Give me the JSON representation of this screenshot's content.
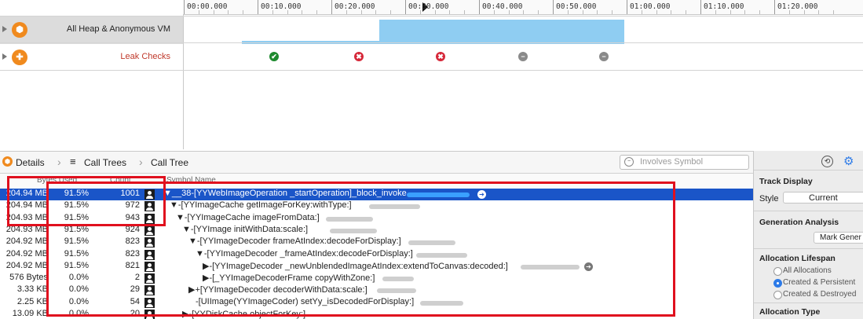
{
  "timeline": {
    "ruler_labels": [
      "00:00.000",
      "00:10.000",
      "00:20.000",
      "00:30.000",
      "00:40.000",
      "00:50.000",
      "01:00.000",
      "01:10.000",
      "01:20.000"
    ],
    "tracks": [
      {
        "label": "All Heap & Anonymous VM",
        "icon": "allocations-icon",
        "label_color": "#222222",
        "selected": true
      },
      {
        "label": "Leak Checks",
        "icon": "leaks-icon",
        "label_color": "#c0392b",
        "selected": false
      }
    ],
    "leak_checks": [
      {
        "status": "ok",
        "color": "#1e8a2e",
        "glyph": "✔"
      },
      {
        "status": "leak",
        "color": "#d62839",
        "glyph": "✖"
      },
      {
        "status": "leak",
        "color": "#d62839",
        "glyph": "✖"
      },
      {
        "status": "none",
        "color": "#8a8a8a",
        "glyph": "−"
      },
      {
        "status": "none",
        "color": "#8a8a8a",
        "glyph": "−"
      }
    ]
  },
  "jumpbar": {
    "details_label": "Details",
    "call_trees_label": "Call Trees",
    "call_tree_label": "Call Tree",
    "search_placeholder": "Involves Symbol"
  },
  "table": {
    "headers": {
      "bytes": "Bytes Used",
      "count": "Count",
      "symbol": "Symbol Name"
    },
    "rows": [
      {
        "bytes": "204.94 MB",
        "pct": "91.5%",
        "count": "1001",
        "symbol": "▼__38-[YYWebImageOperation _startOperation]_block_invoke",
        "selected": true
      },
      {
        "bytes": "204.94 MB",
        "pct": "91.5%",
        "count": "972",
        "symbol": "▼-[YYImageCache getImageForKey:withType:]"
      },
      {
        "bytes": "204.93 MB",
        "pct": "91.5%",
        "count": "943",
        "symbol": "▼-[YYImageCache imageFromData:]"
      },
      {
        "bytes": "204.93 MB",
        "pct": "91.5%",
        "count": "924",
        "symbol": "▼-[YYImage initWithData:scale:]"
      },
      {
        "bytes": "204.92 MB",
        "pct": "91.5%",
        "count": "823",
        "symbol": "▼-[YYImageDecoder frameAtIndex:decodeForDisplay:]"
      },
      {
        "bytes": "204.92 MB",
        "pct": "91.5%",
        "count": "823",
        "symbol": "▼-[YYImageDecoder _frameAtIndex:decodeForDisplay:]"
      },
      {
        "bytes": "204.92 MB",
        "pct": "91.5%",
        "count": "821",
        "symbol": "▶-[YYImageDecoder _newUnblendedImageAtIndex:extendToCanvas:decoded:]"
      },
      {
        "bytes": "576 Bytes",
        "pct": "0.0%",
        "count": "2",
        "symbol": "▶-[_YYImageDecoderFrame copyWithZone:]"
      },
      {
        "bytes": "3.33 KB",
        "pct": "0.0%",
        "count": "29",
        "symbol": "▶+[YYImageDecoder decoderWithData:scale:]"
      },
      {
        "bytes": "2.25 KB",
        "pct": "0.0%",
        "count": "54",
        "symbol": "-[UIImage(YYImageCoder) setYy_isDecodedForDisplay:]"
      },
      {
        "bytes": "13.09 KB",
        "pct": "0.0%",
        "count": "20",
        "symbol": "▶-[YYDiskCache objectForKey:]"
      }
    ]
  },
  "inspector": {
    "track_display": "Track Display",
    "style_label": "Style",
    "style_value": "Current",
    "generation_analysis": "Generation Analysis",
    "mark_generation": "Mark Gener",
    "allocation_lifespan": "Allocation Lifespan",
    "lifespan_options": [
      "All Allocations",
      "Created & Persistent",
      "Created & Destroyed"
    ],
    "lifespan_selected": 1,
    "allocation_type": "Allocation Type"
  },
  "colors": {
    "selection": "#1a55c8",
    "heap_graph": "#8fcdf2",
    "annotation": "#e0101e",
    "instrument_icon": "#f08a1e"
  }
}
